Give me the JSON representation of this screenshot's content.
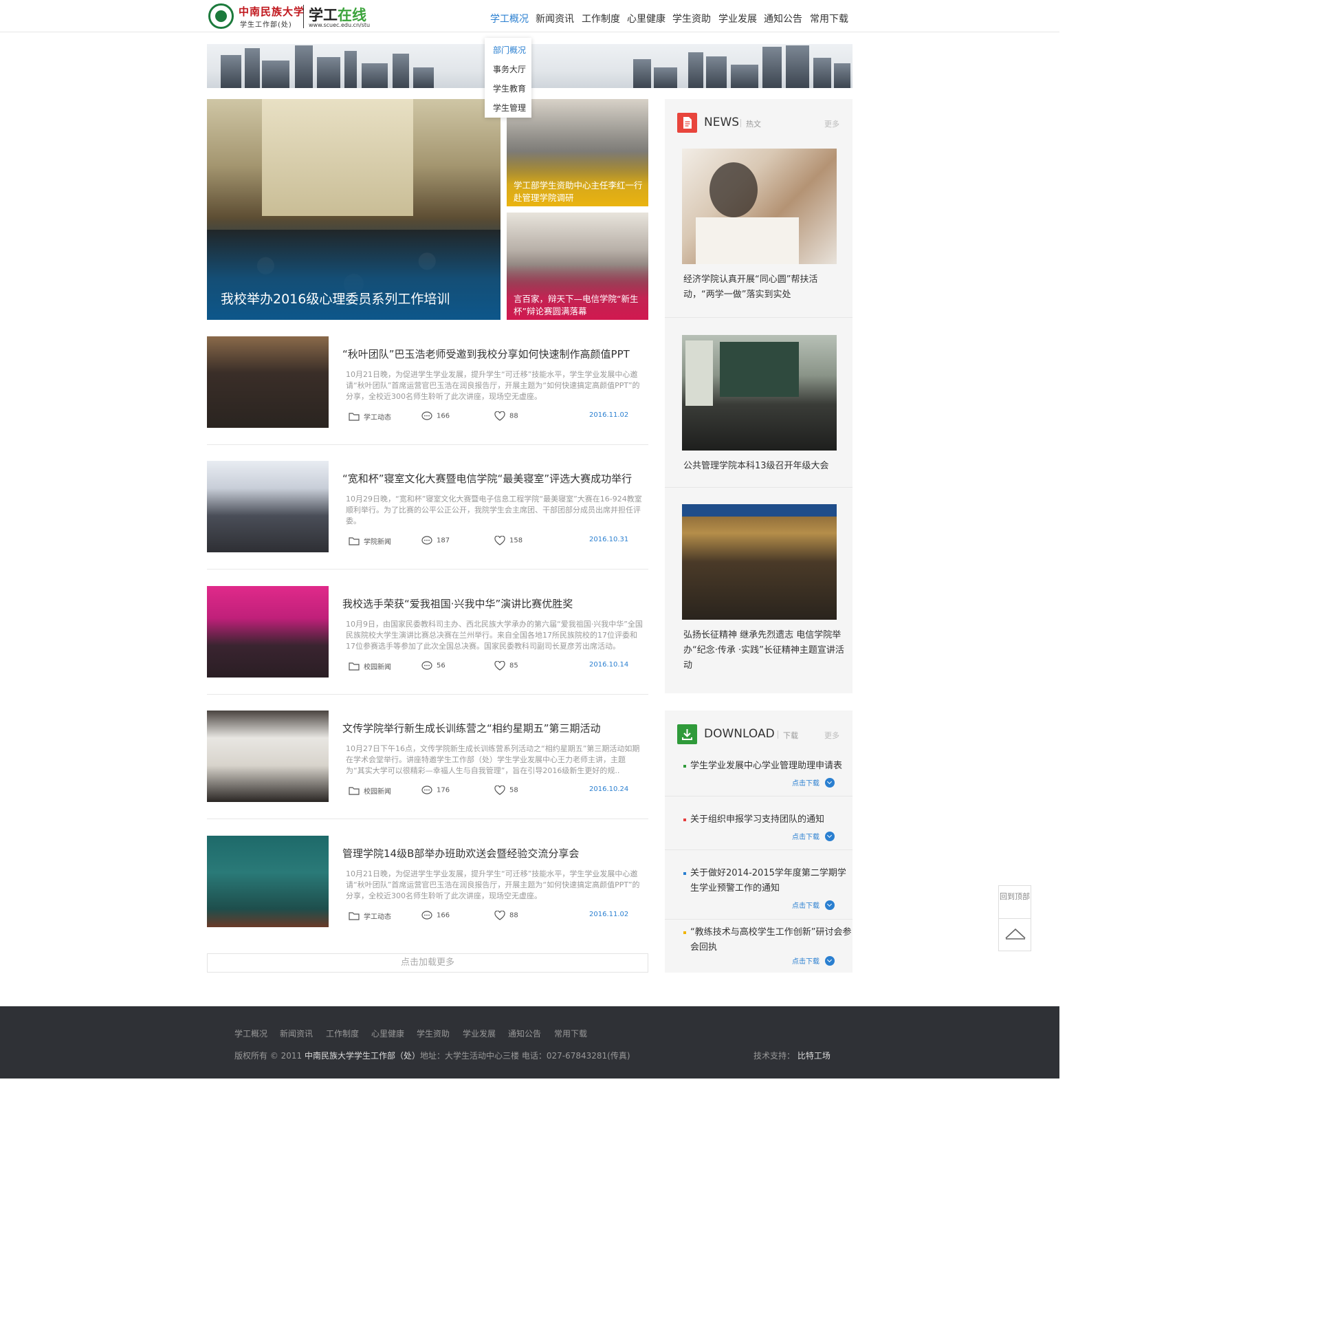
{
  "header": {
    "logo": {
      "university": "中南民族大学",
      "department": "学生工作部(处)",
      "brand_prefix": "学工",
      "brand_suffix": "在线",
      "url": "www.scuec.edu.cn/stu"
    },
    "nav": [
      "学工概况",
      "新闻资讯",
      "工作制度",
      "心里健康",
      "学生资助",
      "学业发展",
      "通知公告",
      "常用下载"
    ],
    "active_nav": "学工概况",
    "dropdown": [
      "部门概况",
      "事务大厅",
      "学生教育",
      "学生管理"
    ],
    "active_dropdown": "部门概况"
  },
  "hero": {
    "main_caption": "我校举办2016级心理委员系列工作培训",
    "side": [
      {
        "caption": "学工部学生资助中心主任李红一行赴管理学院调研"
      },
      {
        "caption": "言百家，辩天下—电信学院“新生杯”辩论赛圆满落幕"
      }
    ]
  },
  "articles": [
    {
      "title": "“秋叶团队”巴玉浩老师受邀到我校分享如何快速制作高颜值PPT",
      "excerpt": "10月21日晚，为促进学生学业发展，提升学生“可迁移”技能水平，学生学业发展中心邀请“秋叶团队”首席运营官巴玉浩在润良报告厅，开展主题为“如何快速搞定高颜值PPT”的分享，全校近300名师生聆听了此次讲座，现场空无虚座。",
      "category": "学工动态",
      "comments": "166",
      "likes": "88",
      "date": "2016.11.02"
    },
    {
      "title": "“宽和杯”寝室文化大赛暨电信学院“最美寝室”评选大赛成功举行",
      "excerpt": "10月29日晚，“宽和杯”寝室文化大赛暨电子信息工程学院“最美寝室”大赛在16-924教室顺利举行。为了比赛的公平公正公开，我院学生会主席团、干部团部分成员出席并担任评委。",
      "category": "学院新闻",
      "comments": "187",
      "likes": "158",
      "date": "2016.10.31"
    },
    {
      "title": "我校选手荣获“爱我祖国·兴我中华”演讲比赛优胜奖",
      "excerpt": "10月9日，由国家民委教科司主办、西北民族大学承办的第六届“爱我祖国·兴我中华”全国民族院校大学生演讲比赛总决赛在兰州举行。来自全国各地17所民族院校的17位评委和17位参赛选手等参加了此次全国总决赛。国家民委教科司副司长夏彦芳出席活动。",
      "category": "校园新闻",
      "comments": "56",
      "likes": "85",
      "date": "2016.10.14"
    },
    {
      "title": "文传学院举行新生成长训练营之“相约星期五”第三期活动",
      "excerpt": "10月27日下午16点，文传学院新生成长训练营系列活动之“相约星期五”第三期活动如期在学术会堂举行。讲座特邀学生工作部（处）学生学业发展中心王力老师主讲，主题为“其实大学可以很精彩—幸福人生与自我管理”，旨在引导2016级新生更好的规..",
      "category": "校园新闻",
      "comments": "176",
      "likes": "58",
      "date": "2016.10.24"
    },
    {
      "title": "管理学院14级B部举办班助欢送会暨经验交流分享会",
      "excerpt": "10月21日晚，为促进学生学业发展，提升学生“可迁移”技能水平，学生学业发展中心邀请“秋叶团队”首席运营官巴玉浩在润良报告厅，开展主题为“如何快速搞定高颜值PPT”的分享，全校近300名师生聆听了此次讲座，现场空无虚座。",
      "category": "学工动态",
      "comments": "166",
      "likes": "88",
      "date": "2016.11.02"
    }
  ],
  "load_more": "点击加载更多",
  "sidebar": {
    "news": {
      "title": "NEWS",
      "subtitle": "热文",
      "more": "更多",
      "items": [
        "经济学院认真开展“同心圆”帮扶活动，“两学一做”落实到实处",
        "公共管理学院本科13级召开年级大会",
        "弘扬长征精神 继承先烈遗志 电信学院举办“纪念·传承 ·实践”长征精神主题宣讲活动"
      ]
    },
    "download": {
      "title": "DOWNLOAD",
      "subtitle": "下载",
      "more": "更多",
      "button": "点击下载",
      "items": [
        {
          "title": "学生学业发展中心学业管理助理申请表",
          "color": "#2f9a3a"
        },
        {
          "title": "关于组织申报学习支持团队的通知",
          "color": "#e63c3c"
        },
        {
          "title": "关于做好2014-2015学年度第二学期学生学业预警工作的通知",
          "color": "#2a7fd0"
        },
        {
          "title": "“教练技术与高校学生工作创新”研讨会参会回执",
          "color": "#f0b400"
        }
      ]
    }
  },
  "back_to_top": "回到顶部",
  "footer": {
    "nav": [
      "学工概况",
      "新闻资讯",
      "工作制度",
      "心里健康",
      "学生资助",
      "学业发展",
      "通知公告",
      "常用下载"
    ],
    "copyright_prefix": "版权所有 © 2011",
    "copyright_org": "中南民族大学学生工作部（处）",
    "copyright_suffix": "地址：大学生活动中心三楼   电话：027-67843281(传真)",
    "tech_label": "技术支持：",
    "tech_name": "比特工场"
  },
  "colors": {
    "accent": "#2a7fd0",
    "news_icon": "#e8453c",
    "download_icon": "#2f9a3a",
    "footer_bg": "#2f3136"
  }
}
